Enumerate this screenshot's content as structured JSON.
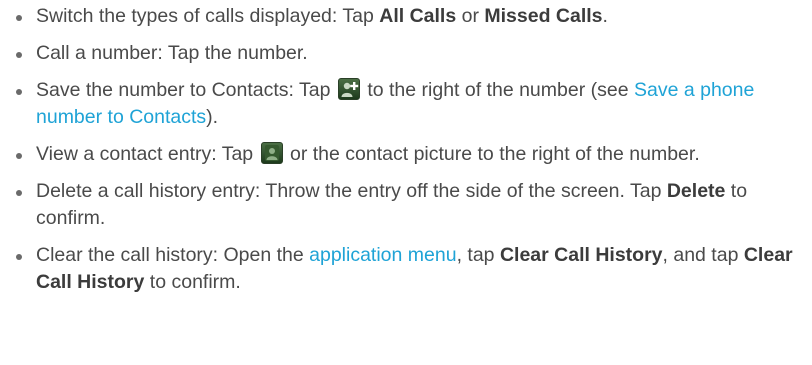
{
  "items": [
    {
      "prefix": "Switch the types of calls displayed: Tap ",
      "bold1": "All Calls",
      "mid": " or ",
      "bold2": "Missed Calls",
      "suffix": "."
    },
    {
      "text": "Call a number: Tap the number."
    },
    {
      "prefix": "Save the number to Contacts: Tap ",
      "icon": "add-contact-icon",
      "mid": " to the right of the number (see ",
      "link": "Save a phone number to Contacts",
      "suffix": ")."
    },
    {
      "prefix": "View a contact entry: Tap ",
      "icon": "contact-icon",
      "suffix": " or the contact picture to the right of the number."
    },
    {
      "prefix": "Delete a call history entry: Throw the entry off the side of the screen. Tap ",
      "bold": "Delete",
      "suffix": " to confirm."
    },
    {
      "prefix": "Clear the call history: Open the ",
      "link": "application menu",
      "mid1": ", tap ",
      "bold1": "Clear Call History",
      "mid2": ", and tap ",
      "bold2": "Clear Call History",
      "suffix": " to confirm."
    }
  ],
  "colors": {
    "text": "#4a4a4a",
    "link": "#1fa3d6",
    "icon_green": "#2f4f2c"
  }
}
